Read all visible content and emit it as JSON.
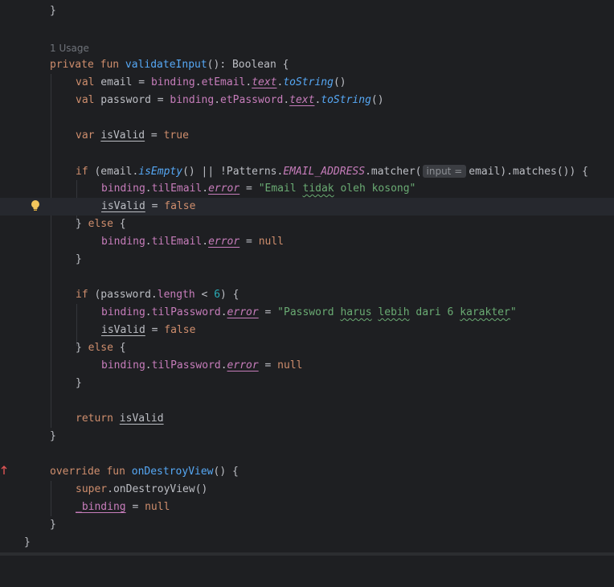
{
  "editor": {
    "code_vision": {
      "usages": "1 Usage"
    },
    "inlay_hint": {
      "param": "input ="
    },
    "lines": {
      "l1": {
        "brace": "}"
      },
      "l2": {
        "kw": "private fun",
        "fn": "validateInput",
        "rest": "(): Boolean {"
      },
      "l3": {
        "kw": "val",
        "name": " email = ",
        "recv": "binding",
        "dot1": ".",
        "prop1": "etEmail",
        "dot2": ".",
        "prop2": "text",
        "dot3": ".",
        "fn": "toString",
        "end": "()"
      },
      "l4": {
        "kw": "val",
        "name": " password = ",
        "recv": "binding",
        "dot1": ".",
        "prop1": "etPassword",
        "dot2": ".",
        "prop2": "text",
        "dot3": ".",
        "fn": "toString",
        "end": "()"
      },
      "l5": {
        "kw": "var",
        "sp": " ",
        "var": "isValid",
        "eq": " = ",
        "val": "true"
      },
      "l6": {
        "kw": "if",
        "p1": " (email.",
        "fn": "isEmpty",
        "p2": "() || !Patterns.",
        "const": "EMAIL_ADDRESS",
        "p3": ".matcher(",
        "p4": "email).matches()) {"
      },
      "l7": {
        "recv": "binding",
        "p1": ".",
        "prop1": "tilEmail",
        "p2": ".",
        "prop2": "error",
        "eq": " = ",
        "s1": "\"Email ",
        "s2": "tidak",
        "s3": " oleh kosong\""
      },
      "l8": {
        "var": "isValid",
        "eq": " = ",
        "val": "false"
      },
      "l9": {
        "p1": "} ",
        "kw": "else",
        "p2": " {"
      },
      "l10": {
        "recv": "binding",
        "p1": ".",
        "prop1": "tilEmail",
        "p2": ".",
        "prop2": "error",
        "eq": " = ",
        "val": "null"
      },
      "l11": {
        "brace": "}"
      },
      "l12": {
        "kw": "if",
        "p1": " (password.",
        "prop": "length",
        "p2": " < ",
        "num": "6",
        "p3": ") {"
      },
      "l13": {
        "recv": "binding",
        "p1": ".",
        "prop1": "tilPassword",
        "p2": ".",
        "prop2": "error",
        "eq": " = ",
        "s1": "\"Password ",
        "s2": "harus",
        "s3": " ",
        "s4": "lebih",
        "s5": " dari 6 ",
        "s6": "karakter",
        "s7": "\""
      },
      "l14": {
        "var": "isValid",
        "eq": " = ",
        "val": "false"
      },
      "l15": {
        "p1": "} ",
        "kw": "else",
        "p2": " {"
      },
      "l16": {
        "recv": "binding",
        "p1": ".",
        "prop1": "tilPassword",
        "p2": ".",
        "prop2": "error",
        "eq": " = ",
        "val": "null"
      },
      "l17": {
        "brace": "}"
      },
      "l18": {
        "kw": "return",
        "sp": " ",
        "var": "isValid"
      },
      "l19": {
        "brace": "}"
      },
      "l20": {
        "kw": "override fun",
        "sp": " ",
        "fn": "onDestroyView",
        "rest": "() {"
      },
      "l21": {
        "kw": "super",
        "rest": ".onDestroyView()"
      },
      "l22": {
        "var": "_binding",
        "eq": " = ",
        "val": "null"
      },
      "l23": {
        "brace": "}"
      },
      "l24": {
        "brace": "}"
      }
    },
    "colors": {
      "background": "#1e1f22",
      "keyword": "#cf8e6d",
      "function": "#56a8f5",
      "property": "#c77dbb",
      "string": "#6aab73",
      "number": "#2aacb8",
      "plain": "#bcbec4"
    },
    "icons": {
      "intention": "lightbulb-icon",
      "override": "override-gutter-icon"
    }
  }
}
